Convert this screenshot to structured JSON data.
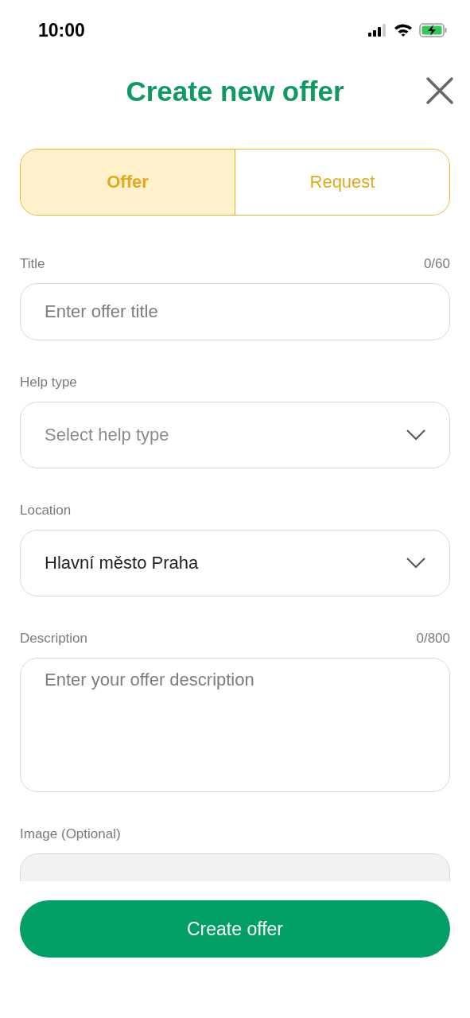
{
  "status_bar": {
    "time": "10:00"
  },
  "header": {
    "title": "Create new offer"
  },
  "tabs": [
    {
      "label": "Offer",
      "selected": true
    },
    {
      "label": "Request",
      "selected": false
    }
  ],
  "fields": [
    {
      "kind": "text",
      "label": "Title",
      "counter": "0/60",
      "placeholder": "Enter offer title"
    },
    {
      "kind": "select",
      "label": "Help type",
      "placeholder": "Select help type"
    },
    {
      "kind": "select",
      "label": "Location",
      "value": "Hlavní město Praha"
    },
    {
      "kind": "textarea",
      "label": "Description",
      "counter": "0/800",
      "placeholder": "Enter your offer description"
    },
    {
      "kind": "image",
      "label": "Image (Optional)"
    }
  ],
  "submit": {
    "label": "Create offer"
  }
}
